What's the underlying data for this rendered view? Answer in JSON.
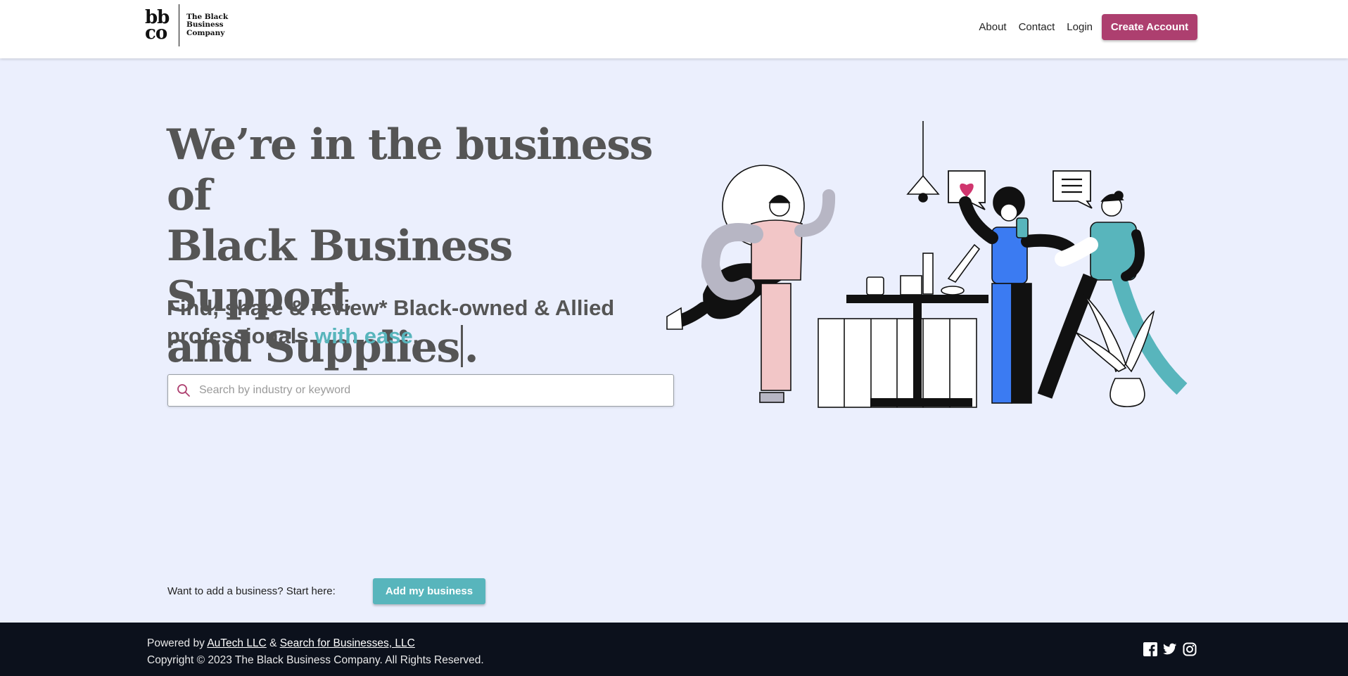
{
  "header": {
    "logo_mark": "bb co",
    "logo_text": "The Black Business Company",
    "nav": {
      "about": "About",
      "contact": "Contact",
      "login": "Login",
      "create_account": "Create Account"
    }
  },
  "hero": {
    "headline_line1": "We’re in the business of",
    "headline_line2": "Black Business Support",
    "headline_line3_prefix": "and Supplies",
    "headline_line3_suffix": ".",
    "subhead_main": "Find, share & review* Black-owned & Allied professionals ",
    "subhead_accent": "with ease",
    "subhead_end": ".",
    "search": {
      "placeholder": "Search by industry or keyword",
      "value": ""
    }
  },
  "add_business": {
    "prompt": "Want to add a business? Start here:",
    "button": "Add my business"
  },
  "footer": {
    "powered_prefix": "Powered by ",
    "link1": "AuTech LLC",
    "amp": " & ",
    "link2": "Search for Businesses, LLC",
    "copyright": "Copyright © 2023 The Black Business Company. All Rights Reserved.",
    "social_icons": [
      "facebook-icon",
      "twitter-icon",
      "instagram-icon"
    ]
  },
  "colors": {
    "brand_primary": "#ad3f6f",
    "brand_accent": "#58b5bc",
    "page_bg": "#ebeffd",
    "footer_bg": "#0c111c"
  }
}
